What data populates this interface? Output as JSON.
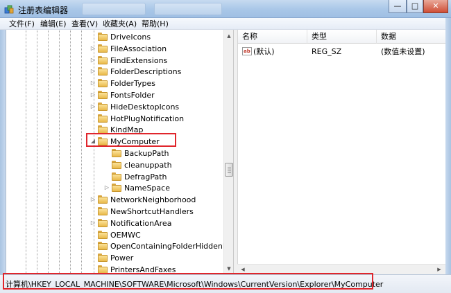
{
  "window": {
    "title": "注册表编辑器",
    "controls": {
      "minimize": "—",
      "maximize": "□",
      "close": "✕"
    }
  },
  "menu": [
    "文件(F)",
    "编辑(E)",
    "查看(V)",
    "收藏夹(A)",
    "帮助(H)"
  ],
  "tree": {
    "rows": [
      {
        "label": "DriveIcons",
        "expander": "",
        "level": 1
      },
      {
        "label": "FileAssociation",
        "expander": "▷",
        "level": 1
      },
      {
        "label": "FindExtensions",
        "expander": "▷",
        "level": 1
      },
      {
        "label": "FolderDescriptions",
        "expander": "▷",
        "level": 1
      },
      {
        "label": "FolderTypes",
        "expander": "▷",
        "level": 1
      },
      {
        "label": "FontsFolder",
        "expander": "▷",
        "level": 1
      },
      {
        "label": "HideDesktopIcons",
        "expander": "▷",
        "level": 1
      },
      {
        "label": "HotPlugNotification",
        "expander": "",
        "level": 1
      },
      {
        "label": "KindMap",
        "expander": "",
        "level": 1
      },
      {
        "label": "MyComputer",
        "expander": "◢",
        "level": 1
      },
      {
        "label": "BackupPath",
        "expander": "",
        "level": 2
      },
      {
        "label": "cleanuppath",
        "expander": "",
        "level": 2
      },
      {
        "label": "DefragPath",
        "expander": "",
        "level": 2
      },
      {
        "label": "NameSpace",
        "expander": "▷",
        "level": 2
      },
      {
        "label": "NetworkNeighborhood",
        "expander": "▷",
        "level": 1
      },
      {
        "label": "NewShortcutHandlers",
        "expander": "",
        "level": 1
      },
      {
        "label": "NotificationArea",
        "expander": "▷",
        "level": 1
      },
      {
        "label": "OEMWC",
        "expander": "",
        "level": 1
      },
      {
        "label": "OpenContainingFolderHiddenList",
        "expander": "",
        "level": 1
      },
      {
        "label": "Power",
        "expander": "",
        "level": 1
      },
      {
        "label": "PrintersAndFaxes",
        "expander": "",
        "level": 1
      }
    ]
  },
  "list": {
    "columns": [
      "名称",
      "类型",
      "数据"
    ],
    "rows": [
      {
        "icon": "ab",
        "name": "(默认)",
        "type": "REG_SZ",
        "data": "(数值未设置)"
      }
    ]
  },
  "status": {
    "path": "计算机\\HKEY_LOCAL_MACHINE\\SOFTWARE\\Microsoft\\Windows\\CurrentVersion\\Explorer\\MyComputer"
  },
  "scroll": {
    "up": "▲",
    "down": "▼",
    "left": "◀",
    "right": "▶"
  }
}
